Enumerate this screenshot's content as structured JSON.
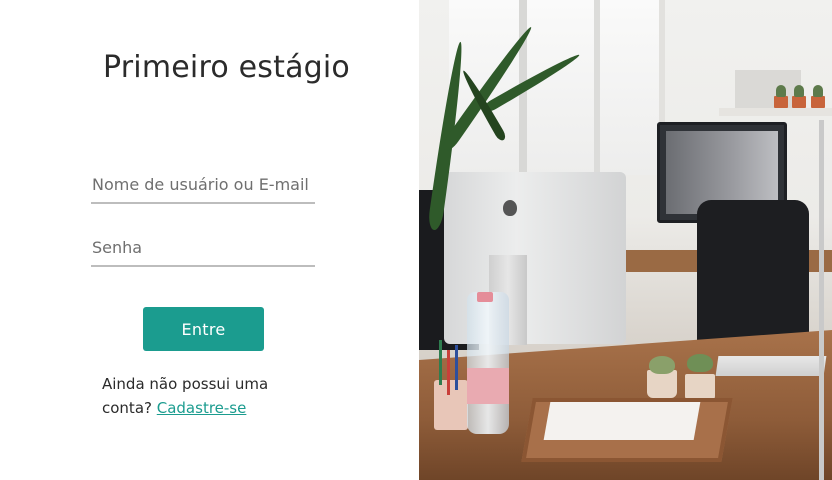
{
  "login": {
    "title": "Primeiro estágio",
    "username_placeholder": "Nome de usuário ou E-mail",
    "password_placeholder": "Senha",
    "submit_label": "Entre",
    "signup_prompt": "Ainda não possui uma conta?",
    "signup_link": "Cadastre-se"
  },
  "colors": {
    "accent": "#1b9c8f",
    "text": "#2b2b2b",
    "input_border": "#bdbdbd"
  },
  "hero": {
    "image_subject": "office workspace photo"
  }
}
